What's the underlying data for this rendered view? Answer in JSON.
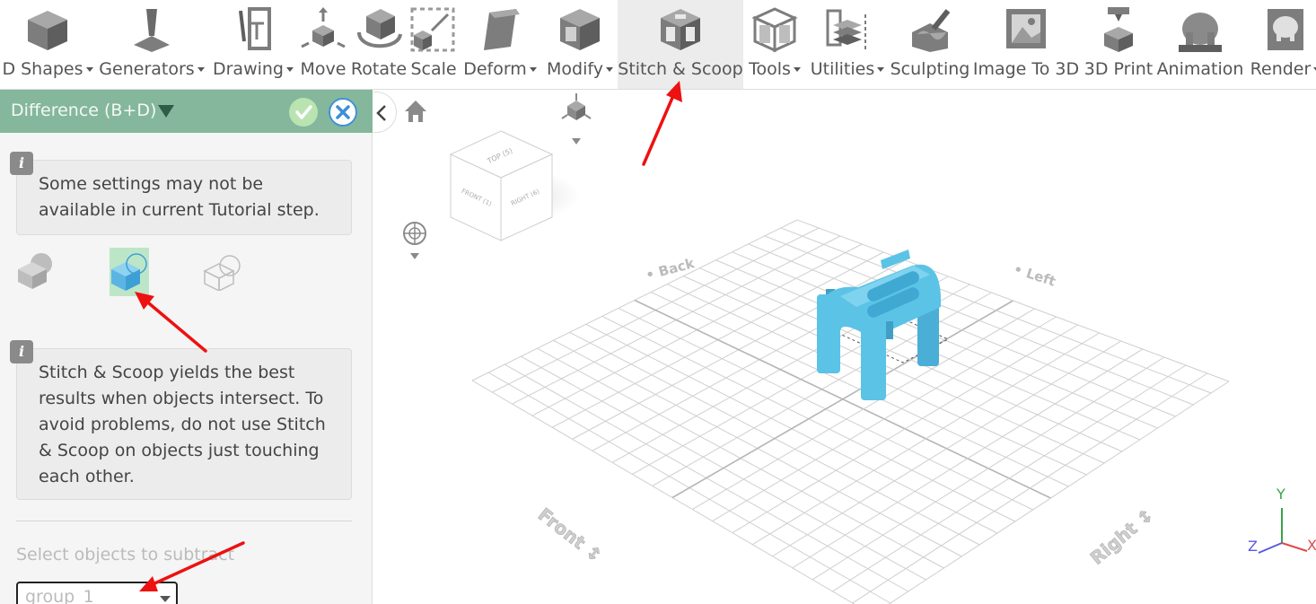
{
  "toolbar": {
    "items": [
      {
        "label": "D Shapes",
        "icon": "3d-shapes-icon",
        "dropdown": true
      },
      {
        "label": "Generators",
        "icon": "generators-icon",
        "dropdown": true
      },
      {
        "label": "Drawing",
        "icon": "drawing-icon",
        "dropdown": true
      },
      {
        "label": "Move",
        "icon": "move-icon",
        "dropdown": false
      },
      {
        "label": "Rotate",
        "icon": "rotate-icon",
        "dropdown": false
      },
      {
        "label": "Scale",
        "icon": "scale-icon",
        "dropdown": false
      },
      {
        "label": "Deform",
        "icon": "deform-icon",
        "dropdown": true
      },
      {
        "label": "Modify",
        "icon": "modify-icon",
        "dropdown": true
      },
      {
        "label": "Stitch & Scoop",
        "icon": "stitch-scoop-icon",
        "dropdown": false,
        "active": true
      },
      {
        "label": "Tools",
        "icon": "tools-icon",
        "dropdown": true
      },
      {
        "label": "Utilities",
        "icon": "utilities-icon",
        "dropdown": true
      },
      {
        "label": "Sculpting",
        "icon": "sculpting-icon",
        "dropdown": false
      },
      {
        "label": "Image To 3D",
        "icon": "image-to-3d-icon",
        "dropdown": false
      },
      {
        "label": "3D Print",
        "icon": "3d-print-icon",
        "dropdown": false
      },
      {
        "label": "Animation",
        "icon": "animation-icon",
        "dropdown": false
      },
      {
        "label": "Render",
        "icon": "render-icon",
        "dropdown": true
      }
    ]
  },
  "panel": {
    "title": "Difference (B+D)",
    "confirm_icon": "check-icon",
    "cancel_icon": "close-icon",
    "info_badge": "i",
    "notice": "Some settings may not be available in current Tutorial step.",
    "operations": [
      {
        "name": "union-op",
        "icon": "union-icon",
        "selected": false
      },
      {
        "name": "difference-op",
        "icon": "difference-icon",
        "selected": true
      },
      {
        "name": "intersection-op",
        "icon": "intersection-icon",
        "selected": false
      }
    ],
    "tip": "Stitch & Scoop yields the best results when objects intersect. To avoid problems, do not use Stitch & Scoop on objects just touching each other.",
    "subtract_label": "Select objects to subtract",
    "subtract_value": "group_1"
  },
  "viewport": {
    "view_cube": {
      "top": "TOP (5)",
      "front": "FRONT (1)",
      "right": "RIGHT (6)"
    },
    "grid_labels": {
      "left_back": "Back",
      "right_back": "Left",
      "left_front": "Front",
      "right_front": "Right"
    },
    "axes": {
      "x": "X",
      "y": "Y",
      "z": "Z"
    },
    "colors": {
      "object": "#5bc3e6",
      "grid": "#cfcfcf",
      "accent_green": "#84b79b",
      "annotation": "#ee1111"
    }
  }
}
